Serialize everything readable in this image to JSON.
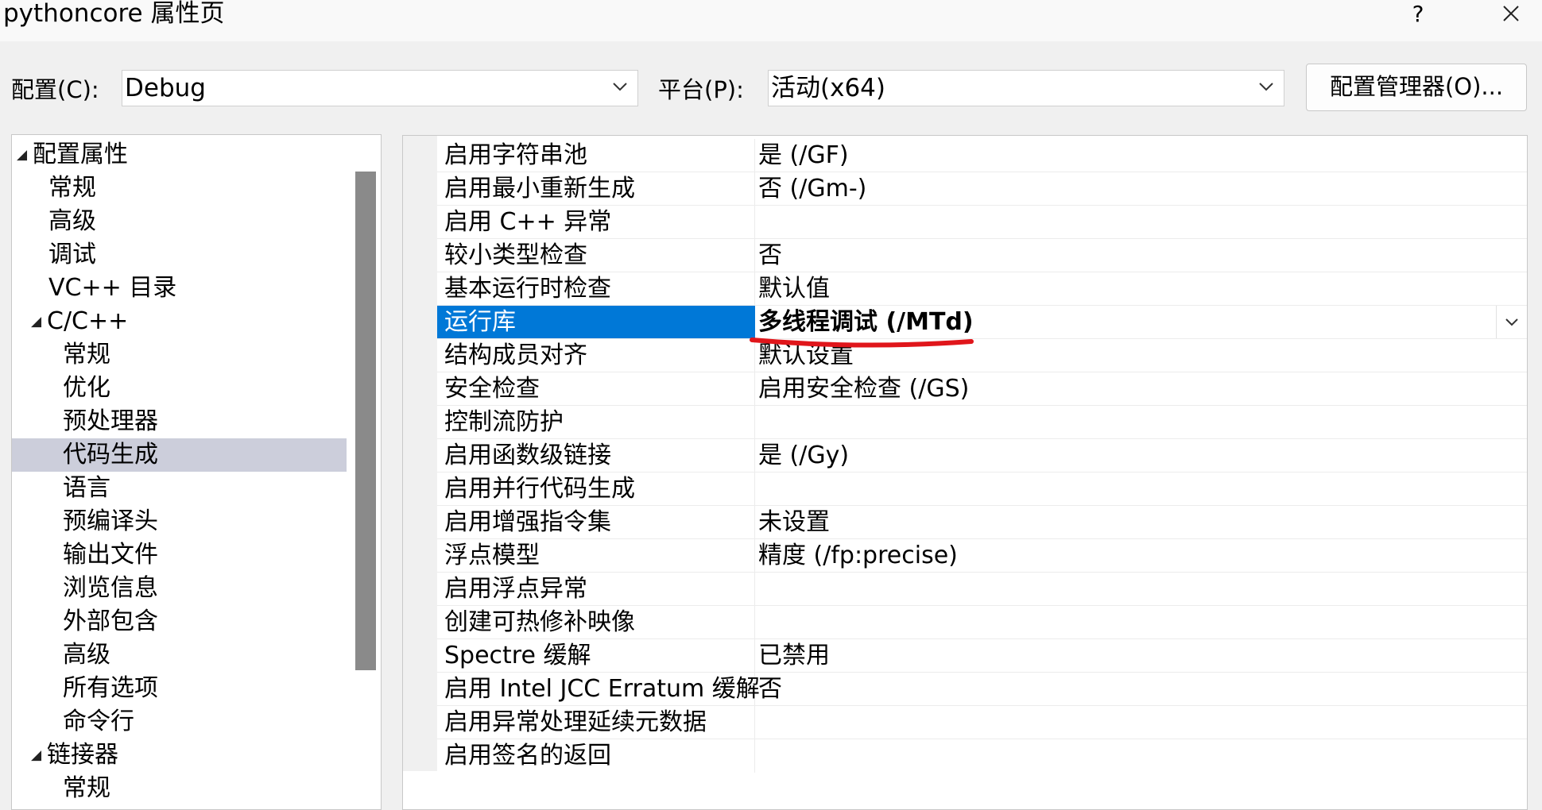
{
  "window": {
    "title": "pythoncore 属性页",
    "help": "?"
  },
  "toolbar": {
    "config_label": "配置(C):",
    "config_value": "Debug",
    "platform_label": "平台(P):",
    "platform_value": "活动(x64)",
    "manager_button": "配置管理器(O)..."
  },
  "tree": {
    "items": [
      {
        "label": "配置属性",
        "level": 0,
        "expanded": true
      },
      {
        "label": "常规",
        "level": 1
      },
      {
        "label": "高级",
        "level": 1
      },
      {
        "label": "调试",
        "level": 1
      },
      {
        "label": "VC++ 目录",
        "level": 1
      },
      {
        "label": "C/C++",
        "level": 1,
        "expanded": true
      },
      {
        "label": "常规",
        "level": 2
      },
      {
        "label": "优化",
        "level": 2
      },
      {
        "label": "预处理器",
        "level": 2
      },
      {
        "label": "代码生成",
        "level": 2,
        "selected": true
      },
      {
        "label": "语言",
        "level": 2
      },
      {
        "label": "预编译头",
        "level": 2
      },
      {
        "label": "输出文件",
        "level": 2
      },
      {
        "label": "浏览信息",
        "level": 2
      },
      {
        "label": "外部包含",
        "level": 2
      },
      {
        "label": "高级",
        "level": 2
      },
      {
        "label": "所有选项",
        "level": 2
      },
      {
        "label": "命令行",
        "level": 2
      },
      {
        "label": "链接器",
        "level": 1,
        "expanded": true
      },
      {
        "label": "常规",
        "level": 2
      }
    ]
  },
  "grid": {
    "rows": [
      {
        "name": "启用字符串池",
        "value": "是 (/GF)"
      },
      {
        "name": "启用最小重新生成",
        "value": "否 (/Gm-)"
      },
      {
        "name": "启用 C++ 异常",
        "value": ""
      },
      {
        "name": "较小类型检查",
        "value": "否"
      },
      {
        "name": "基本运行时检查",
        "value": "默认值"
      },
      {
        "name": "运行库",
        "value": "多线程调试 (/MTd)",
        "selected": true
      },
      {
        "name": "结构成员对齐",
        "value": "默认设置"
      },
      {
        "name": "安全检查",
        "value": "启用安全检查 (/GS)"
      },
      {
        "name": "控制流防护",
        "value": ""
      },
      {
        "name": "启用函数级链接",
        "value": "是 (/Gy)"
      },
      {
        "name": "启用并行代码生成",
        "value": ""
      },
      {
        "name": "启用增强指令集",
        "value": "未设置"
      },
      {
        "name": "浮点模型",
        "value": "精度 (/fp:precise)"
      },
      {
        "name": "启用浮点异常",
        "value": ""
      },
      {
        "name": "创建可热修补映像",
        "value": ""
      },
      {
        "name": "Spectre 缓解",
        "value": "已禁用"
      },
      {
        "name": "启用 Intel JCC Erratum 缓解",
        "value": "否"
      },
      {
        "name": "启用异常处理延续元数据",
        "value": ""
      },
      {
        "name": "启用签名的返回",
        "value": ""
      }
    ]
  },
  "colors": {
    "selection_blue": "#0078d7",
    "tree_selection": "#cccedb",
    "annotation_red": "#e0161b"
  },
  "icons": {
    "tree_expanded": "triangle-expanded-icon",
    "dropdown": "chevron-down-icon",
    "close": "close-icon"
  }
}
